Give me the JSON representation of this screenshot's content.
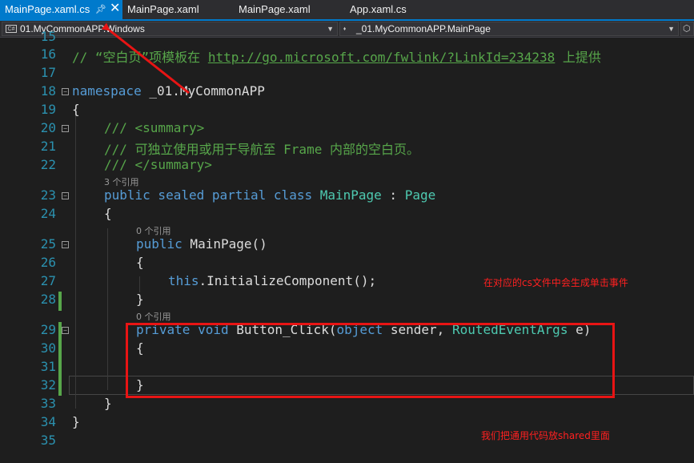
{
  "tabs": [
    {
      "label": "MainPage.xaml.cs",
      "active": true
    },
    {
      "label": "MainPage.xaml"
    },
    {
      "label": "MainPage.xaml"
    },
    {
      "label": "App.xaml.cs"
    }
  ],
  "nav": {
    "project_icon": "C#",
    "project": "01.MyCommonAPP.Windows",
    "type_icon": "class-icon",
    "type": "_01.MyCommonAPP.MainPage"
  },
  "editor": {
    "line_numbers": [
      "15",
      "16",
      "17",
      "18",
      "19",
      "20",
      "21",
      "22",
      "23",
      "24",
      "25",
      "26",
      "27",
      "28",
      "29",
      "30",
      "31",
      "32",
      "33",
      "34",
      "35"
    ],
    "l16": {
      "prefix": "// “空白页”项模板在 ",
      "link": "http://go.microsoft.com/fwlink/?LinkId=234238",
      "suffix": " 上提供"
    },
    "l18": {
      "kw": "namespace",
      "name": " _01.MyCommonAPP"
    },
    "l19": "{",
    "l20": "/// <summary>",
    "l21": "/// 可独立使用或用于导航至 Frame 内部的空白页。",
    "l22": "/// </summary>",
    "ref1": "3 个引用",
    "l23": {
      "kw": "public sealed partial class",
      "cls": "MainPage",
      "colon": " : ",
      "base": "Page"
    },
    "l24": "{",
    "ref2": "0 个引用",
    "l25": {
      "kw": "public",
      "rest": " MainPage()"
    },
    "l26": "{",
    "l27": {
      "kw": "this",
      "rest": ".InitializeComponent();"
    },
    "l28": "}",
    "ref3": "0 个引用",
    "l29": {
      "kw1": "private void",
      "name": " Button_Click(",
      "kw2": "object",
      "mid": " sender, ",
      "ty": "RoutedEventArgs",
      "end": " e)"
    },
    "l30": "{",
    "l32": "}",
    "l33": "}",
    "l34": "}"
  },
  "annotations": {
    "note1": "在对应的cs文件中会生成单击事件",
    "note2": "我们把通用代码放shared里面"
  },
  "colors": {
    "accent": "#007acc",
    "annotation": "#e81414",
    "comment": "#57a64a",
    "keyword": "#569cd6",
    "type": "#4ec9b0"
  }
}
